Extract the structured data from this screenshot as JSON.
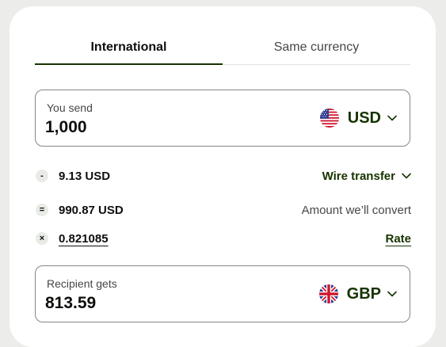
{
  "tabs": [
    {
      "label": "International",
      "active": true
    },
    {
      "label": "Same currency",
      "active": false
    }
  ],
  "send": {
    "label": "You send",
    "amount": "1,000",
    "currency": "USD",
    "flag": "us-flag-icon"
  },
  "breakdown": {
    "fee": {
      "operator": "-",
      "value": "9.13 USD",
      "method": "Wire transfer"
    },
    "convert": {
      "operator": "=",
      "value": "990.87 USD",
      "label": "Amount we’ll convert"
    },
    "rate": {
      "operator": "×",
      "value": "0.821085",
      "label": "Rate"
    }
  },
  "receive": {
    "label": "Recipient gets",
    "amount": "813.59",
    "currency": "GBP",
    "flag": "uk-flag-icon"
  },
  "colors": {
    "brand_dark": "#163300",
    "text": "#0e0f0c",
    "muted": "#454745",
    "border": "#868685"
  }
}
